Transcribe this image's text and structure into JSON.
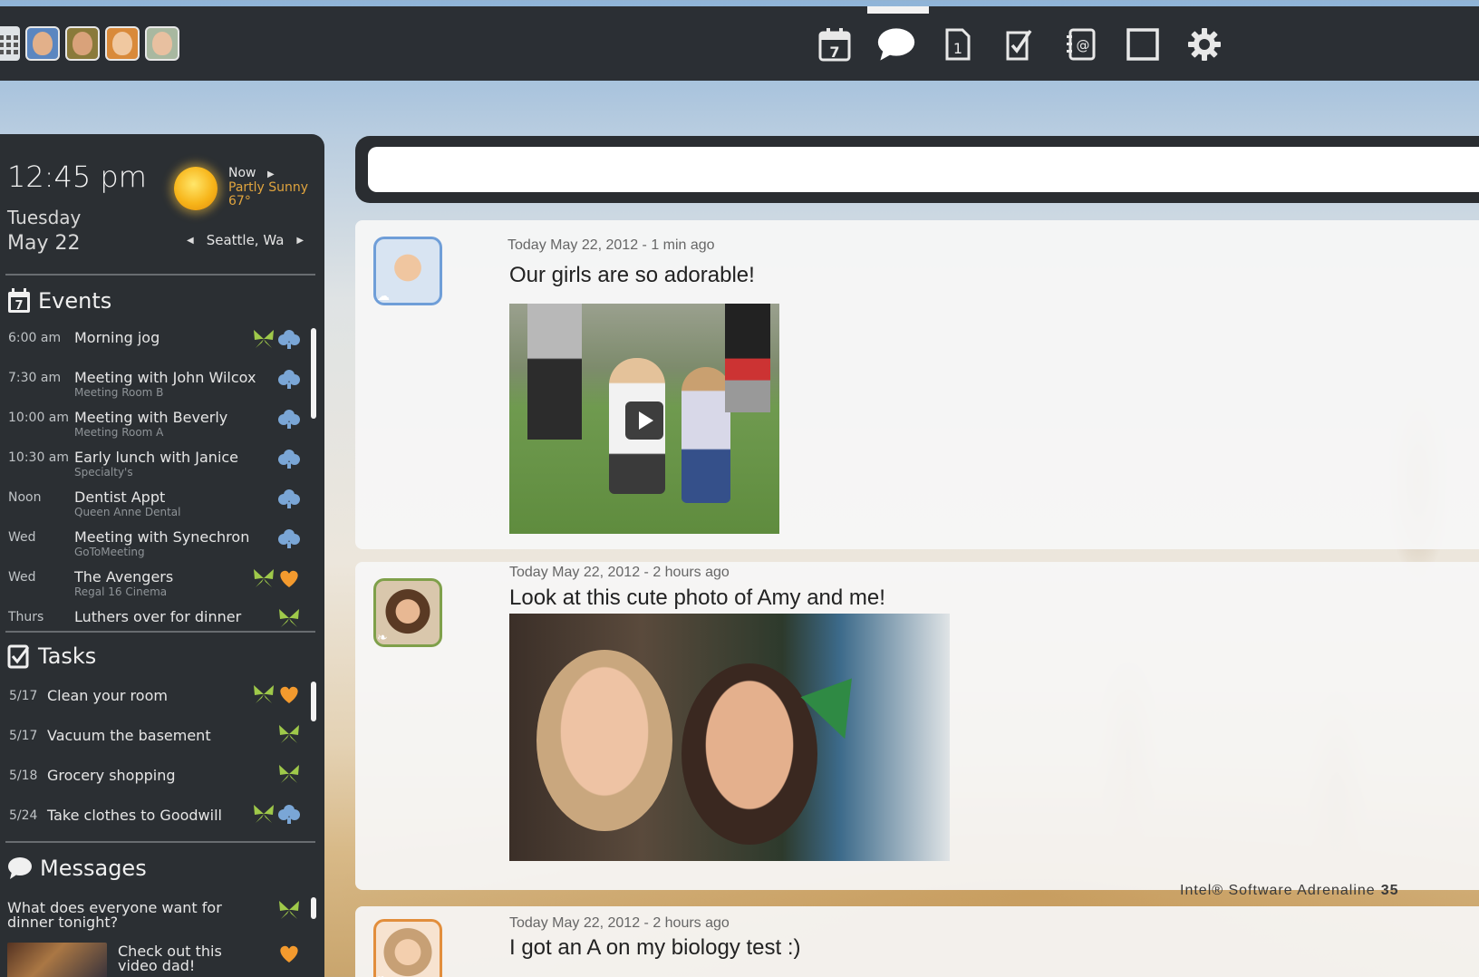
{
  "colors": {
    "butterfly": "#9fc94a",
    "cloud": "#7aa6d6",
    "heart": "#f39a2e",
    "accent_weather": "#e0a43e",
    "panel": "#2b2f33"
  },
  "topbar": {
    "left_avatars": [
      "family-member-1",
      "family-member-2",
      "family-member-3",
      "family-member-4"
    ],
    "nav": [
      {
        "icon": "calendar-icon",
        "label": "7"
      },
      {
        "icon": "chat-bubble-icon",
        "label": ""
      },
      {
        "icon": "note-icon",
        "label": "1"
      },
      {
        "icon": "checklist-icon",
        "label": ""
      },
      {
        "icon": "contacts-icon",
        "label": ""
      },
      {
        "icon": "frame-icon",
        "label": ""
      },
      {
        "icon": "gear-icon",
        "label": ""
      }
    ]
  },
  "panel": {
    "time": "12:45 pm",
    "day": "Tuesday",
    "date": "May 22",
    "weather": {
      "now": "Now",
      "condition": "Partly Sunny",
      "temp": "67°"
    },
    "location": "Seattle, Wa",
    "events_title": "Events",
    "events": [
      {
        "when": "6:00 am",
        "title": "Morning jog",
        "sub": "",
        "tags": [
          "butterfly",
          "cloud"
        ]
      },
      {
        "when": "7:30 am",
        "title": "Meeting with John Wilcox",
        "sub": "Meeting Room B",
        "tags": [
          "cloud"
        ]
      },
      {
        "when": "10:00 am",
        "title": "Meeting with Beverly",
        "sub": "Meeting Room A",
        "tags": [
          "cloud"
        ]
      },
      {
        "when": "10:30 am",
        "title": "Early lunch with Janice",
        "sub": "Specialty's",
        "tags": [
          "cloud"
        ]
      },
      {
        "when": "Noon",
        "title": "Dentist Appt",
        "sub": "Queen Anne Dental",
        "tags": [
          "cloud"
        ]
      },
      {
        "when": "Wed",
        "title": "Meeting with Synechron",
        "sub": "GoToMeeting",
        "tags": [
          "cloud"
        ]
      },
      {
        "when": "Wed",
        "title": "The Avengers",
        "sub": "Regal 16 Cinema",
        "tags": [
          "butterfly",
          "heart"
        ]
      },
      {
        "when": "Thurs",
        "title": "Luthers over for dinner",
        "sub": "",
        "tags": [
          "butterfly"
        ]
      }
    ],
    "tasks_title": "Tasks",
    "tasks": [
      {
        "when": "5/17",
        "title": "Clean your room",
        "tags": [
          "butterfly",
          "heart"
        ]
      },
      {
        "when": "5/17",
        "title": "Vacuum the basement",
        "tags": [
          "butterfly"
        ]
      },
      {
        "when": "5/18",
        "title": "Grocery shopping",
        "tags": [
          "butterfly"
        ]
      },
      {
        "when": "5/24",
        "title": "Take clothes to Goodwill",
        "tags": [
          "butterfly",
          "cloud"
        ]
      }
    ],
    "messages_title": "Messages",
    "messages": [
      {
        "text": "What does everyone want for dinner tonight?",
        "tags": [
          "butterfly"
        ]
      },
      {
        "text": "Check out this video dad!",
        "tags": [
          "heart"
        ]
      }
    ]
  },
  "search": {
    "placeholder": ""
  },
  "posts": [
    {
      "stamp": "Today May 22, 2012 - 1 min ago",
      "title": "Our girls are so adorable!",
      "badge": "cloud",
      "media": "video"
    },
    {
      "stamp": "Today May 22, 2012 - 2 hours ago",
      "title": "Look at this cute photo of Amy and me!",
      "badge": "butterfly",
      "media": "photo"
    },
    {
      "stamp": "Today May 22, 2012 - 2 hours ago",
      "title": "I got an A on my biology test :)",
      "badge": "heart",
      "media": "none"
    }
  ],
  "footer": {
    "brand": "Intel® Software Adrenaline",
    "page": "35"
  }
}
